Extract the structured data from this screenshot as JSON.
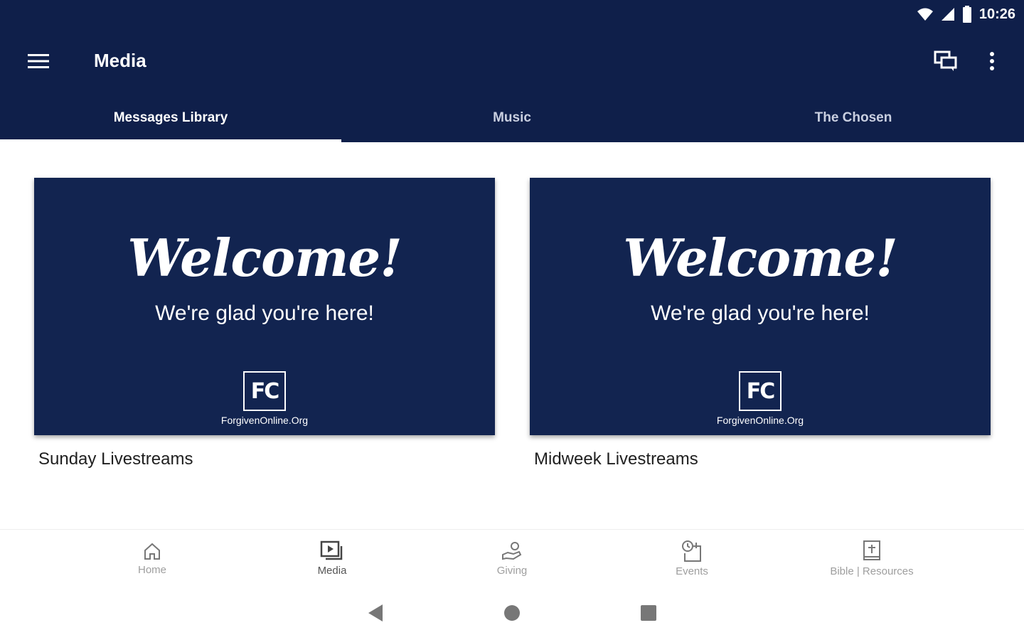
{
  "status": {
    "time": "10:26"
  },
  "header": {
    "title": "Media"
  },
  "tabs": [
    {
      "label": "Messages Library",
      "active": true
    },
    {
      "label": "Music",
      "active": false
    },
    {
      "label": "The Chosen",
      "active": false
    }
  ],
  "cards": [
    {
      "welcome": "Welcome!",
      "tagline": "We're glad you're here!",
      "logo": "FC",
      "url": "ForgivenOnline.Org",
      "title": "Sunday Livestreams"
    },
    {
      "welcome": "Welcome!",
      "tagline": "We're glad you're here!",
      "logo": "FC",
      "url": "ForgivenOnline.Org",
      "title": "Midweek Livestreams"
    }
  ],
  "bottom_nav": [
    {
      "label": "Home",
      "icon": "home-icon"
    },
    {
      "label": "Media",
      "icon": "media-icon"
    },
    {
      "label": "Giving",
      "icon": "giving-icon"
    },
    {
      "label": "Events",
      "icon": "events-icon"
    },
    {
      "label": "Bible | Resources",
      "icon": "bible-icon"
    }
  ],
  "colors": {
    "primary": "#0f1f4a",
    "thumb": "#122450",
    "text": "#1f1f1f",
    "nav_inactive": "#9e9e9e"
  }
}
